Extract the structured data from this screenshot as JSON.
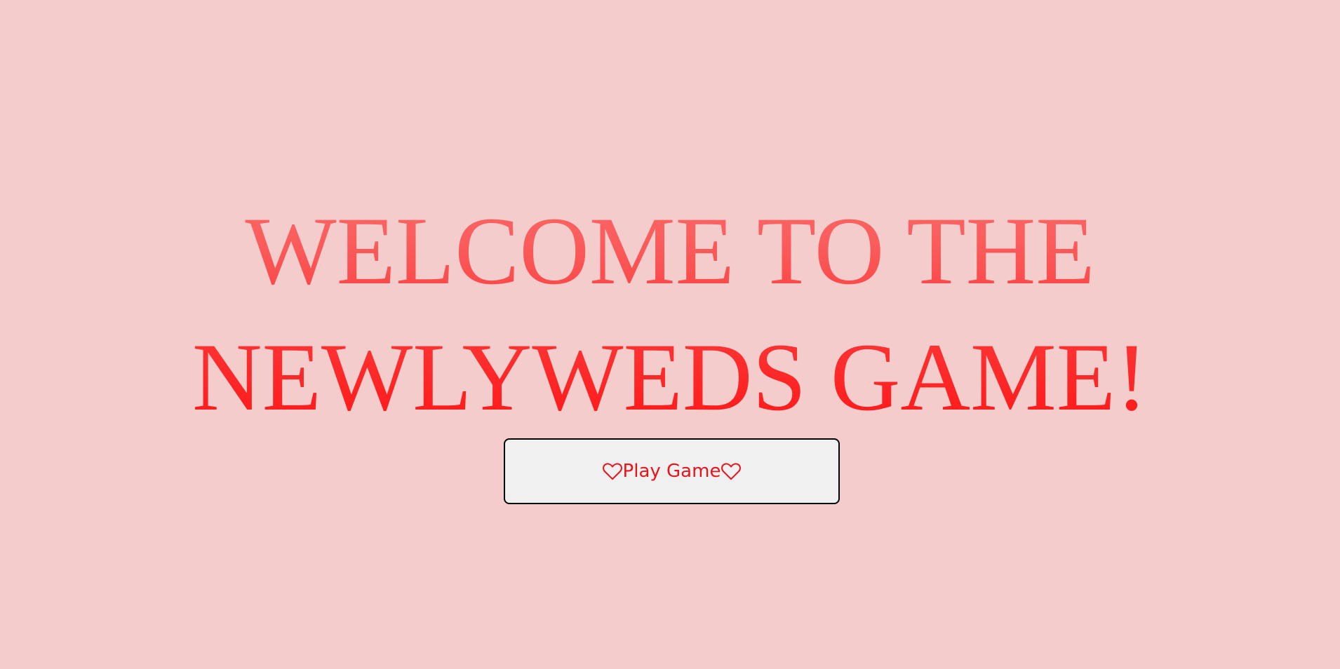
{
  "title": {
    "line1": "WELCOME TO THE",
    "line2": "NEWLYWEDS GAME!"
  },
  "play_button": {
    "label": "Play Game",
    "icon_left": "heart-icon",
    "icon_right": "heart-icon"
  },
  "colors": {
    "background": "#f5cccc",
    "title_top": "#fa6b6b",
    "title_bottom": "#ff1414",
    "button_bg": "#f0f0f0",
    "button_text": "#e8141c",
    "button_border": "#000000"
  }
}
